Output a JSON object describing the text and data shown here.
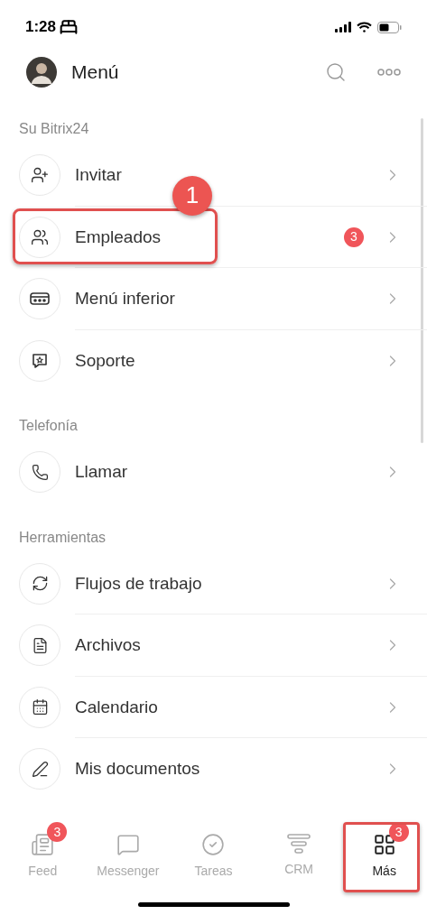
{
  "status_bar": {
    "time": "1:28"
  },
  "header": {
    "title": "Menú"
  },
  "sections": [
    {
      "title": "Su Bitrix24",
      "items": [
        {
          "label": "Invitar",
          "highlighted": false
        },
        {
          "label": "Empleados",
          "badge": "3",
          "highlighted": true,
          "callout": "1"
        },
        {
          "label": "Menú inferior",
          "highlighted": false
        },
        {
          "label": "Soporte",
          "highlighted": false
        }
      ]
    },
    {
      "title": "Telefonía",
      "items": [
        {
          "label": "Llamar",
          "highlighted": false
        }
      ]
    },
    {
      "title": "Herramientas",
      "items": [
        {
          "label": "Flujos de trabajo",
          "highlighted": false
        },
        {
          "label": "Archivos",
          "highlighted": false
        },
        {
          "label": "Calendario",
          "highlighted": false
        },
        {
          "label": "Mis documentos",
          "highlighted": false
        }
      ]
    }
  ],
  "tab_bar": [
    {
      "label": "Feed",
      "badge": "3",
      "selected": false,
      "highlighted": false
    },
    {
      "label": "Messenger",
      "selected": false,
      "highlighted": false
    },
    {
      "label": "Tareas",
      "selected": false,
      "highlighted": false
    },
    {
      "label": "CRM",
      "selected": false,
      "highlighted": false
    },
    {
      "label": "Más",
      "badge": "3",
      "selected": true,
      "highlighted": true
    }
  ]
}
